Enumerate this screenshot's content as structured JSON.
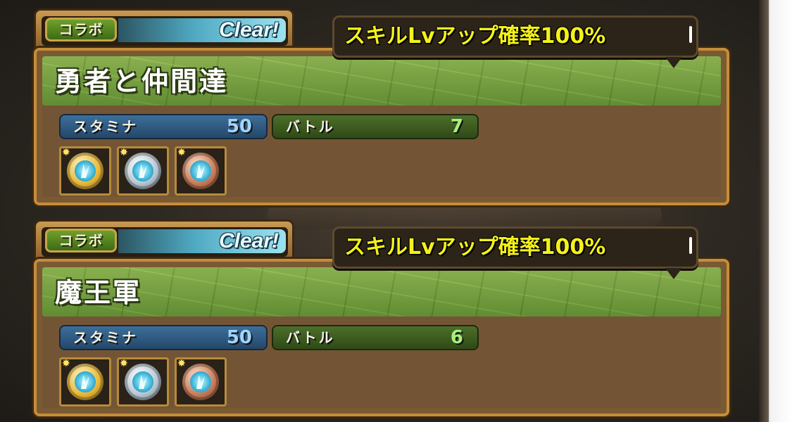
{
  "dungeons": [
    {
      "category_label": "コラボ",
      "status_label": "Clear!",
      "skill_up_text": "スキルLvアップ確率100%",
      "title": "勇者と仲間達",
      "stamina_label": "スタミナ",
      "stamina_value": "50",
      "battle_label": "バトル",
      "battle_value": "7",
      "medals": [
        "gold-medal-icon",
        "silver-medal-icon",
        "bronze-medal-icon"
      ]
    },
    {
      "category_label": "コラボ",
      "status_label": "Clear!",
      "skill_up_text": "スキルLvアップ確率100%",
      "title": "魔王軍",
      "stamina_label": "スタミナ",
      "stamina_value": "50",
      "battle_label": "バトル",
      "battle_value": "6",
      "medals": [
        "gold-medal-icon",
        "silver-medal-icon",
        "bronze-medal-icon"
      ]
    }
  ],
  "colors": {
    "panel_border": "#c78c3a",
    "title_band": "#7aa83a",
    "stamina_bar": "#2f5a80",
    "battle_bar": "#3e5c20",
    "callout_text": "#f4f11a",
    "clear_text": "#e8fbff"
  }
}
